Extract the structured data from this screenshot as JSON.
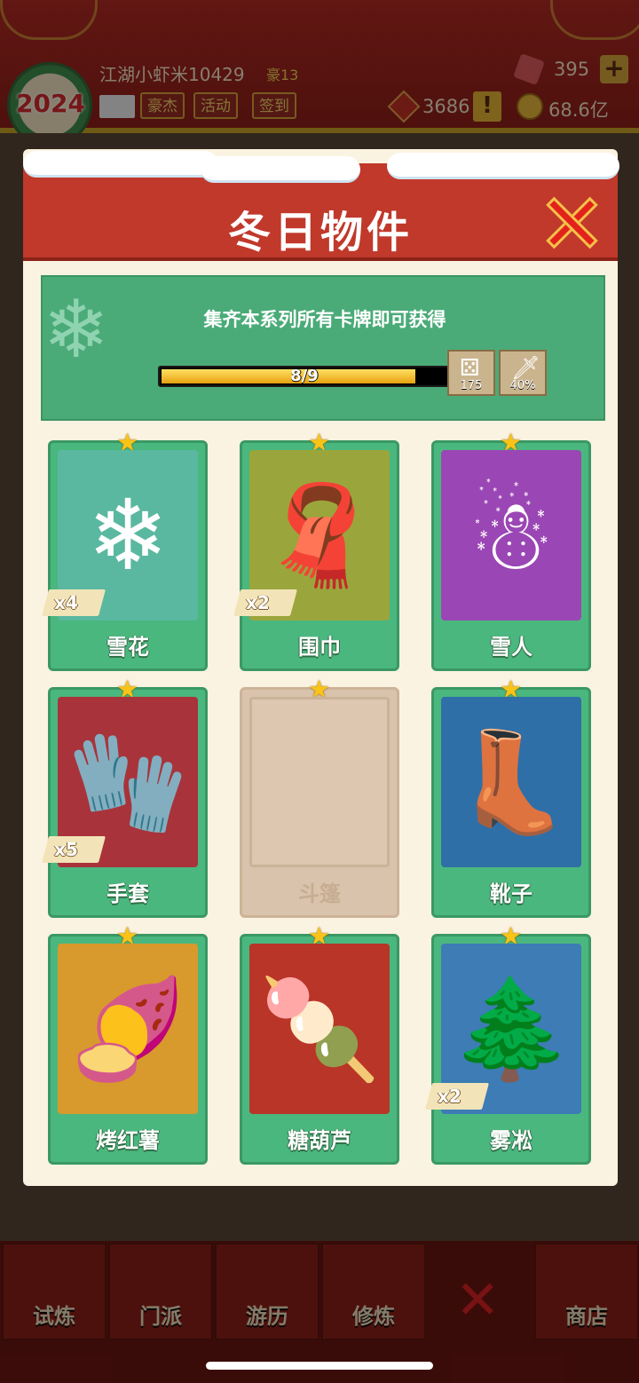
{
  "player": {
    "name": "江湖小虾米10429",
    "vip": "豪13",
    "avatar_year": "2024"
  },
  "top_buttons": [
    "豪杰",
    "活动",
    "签到"
  ],
  "resources": {
    "gems": "395",
    "tokens": "3686",
    "coins": "68.6亿"
  },
  "modal": {
    "title": "冬日物件",
    "banner_text": "集齐本系列所有卡牌即可获得",
    "progress": {
      "current": 8,
      "total": 9,
      "label": "8/9"
    },
    "rewards": [
      {
        "icon": "dice-icon",
        "value": "175"
      },
      {
        "icon": "sword-icon",
        "value": "40%"
      }
    ]
  },
  "cards": [
    {
      "name": "雪花",
      "count": "x4",
      "icon": "snowflake-icon",
      "owned": true,
      "color": "#5ab8a0"
    },
    {
      "name": "围巾",
      "count": "x2",
      "icon": "scarf-icon",
      "owned": true,
      "color": "#9aa63c"
    },
    {
      "name": "雪人",
      "count": "",
      "icon": "snowman-icon",
      "owned": true,
      "color": "#9b46b5"
    },
    {
      "name": "手套",
      "count": "x5",
      "icon": "gloves-icon",
      "owned": true,
      "color": "#a8333a"
    },
    {
      "name": "斗篷",
      "count": "",
      "icon": "cloak-icon",
      "owned": false,
      "color": "#ddc7b0"
    },
    {
      "name": "靴子",
      "count": "",
      "icon": "boots-icon",
      "owned": true,
      "color": "#2f6fa8"
    },
    {
      "name": "烤红薯",
      "count": "",
      "icon": "sweet-potato-icon",
      "owned": true,
      "color": "#d89a2c"
    },
    {
      "name": "糖葫芦",
      "count": "",
      "icon": "candied-haws-icon",
      "owned": true,
      "color": "#b83527"
    },
    {
      "name": "雾凇",
      "count": "x2",
      "icon": "rime-tree-icon",
      "owned": true,
      "color": "#3d7cb5"
    }
  ],
  "bottom_nav": [
    "试炼",
    "门派",
    "游历",
    "修炼",
    "",
    "商店"
  ]
}
